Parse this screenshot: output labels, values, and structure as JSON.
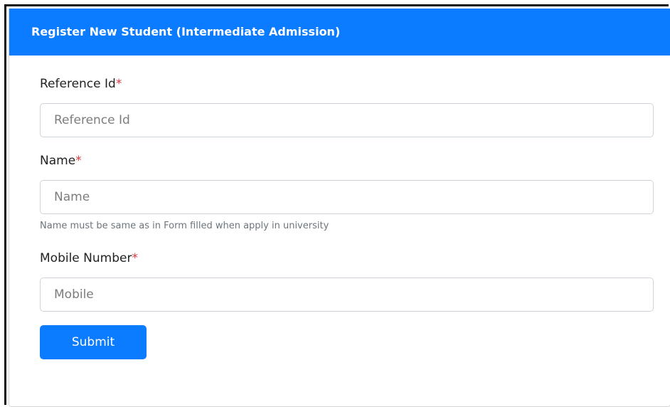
{
  "form": {
    "title": "Register New Student (Intermediate Admission)",
    "fields": [
      {
        "label": "Reference Id",
        "required_mark": "*",
        "placeholder": "Reference Id",
        "value": ""
      },
      {
        "label": "Name",
        "required_mark": "*",
        "placeholder": "Name",
        "value": "",
        "help": "Name must be same as in Form filled when apply in university"
      },
      {
        "label": "Mobile Number",
        "required_mark": "*",
        "placeholder": "Mobile",
        "value": ""
      }
    ],
    "submit_label": "Submit"
  },
  "colors": {
    "primary": "#0b7bff",
    "required": "#d9363e",
    "help_text": "#6c757d"
  }
}
